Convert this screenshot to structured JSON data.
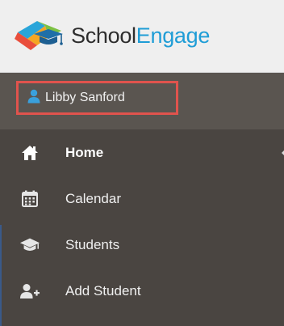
{
  "header": {
    "brand_part1": "School",
    "brand_part2": "Engage",
    "brand_color": "#1f9dd6"
  },
  "user": {
    "name": "Libby Sanford",
    "icon": "user-icon",
    "highlight_color": "#e0534d"
  },
  "menu": {
    "items": [
      {
        "label": "Home",
        "icon": "home-icon",
        "active": true
      },
      {
        "label": "Calendar",
        "icon": "calendar-icon",
        "active": false
      },
      {
        "label": "Students",
        "icon": "graduation-cap-icon",
        "active": false
      },
      {
        "label": "Add Student",
        "icon": "add-user-icon",
        "active": false
      }
    ]
  },
  "colors": {
    "sidebar_bg": "#4a4541",
    "user_row_bg": "#5a5550",
    "header_bg": "#efefef"
  }
}
